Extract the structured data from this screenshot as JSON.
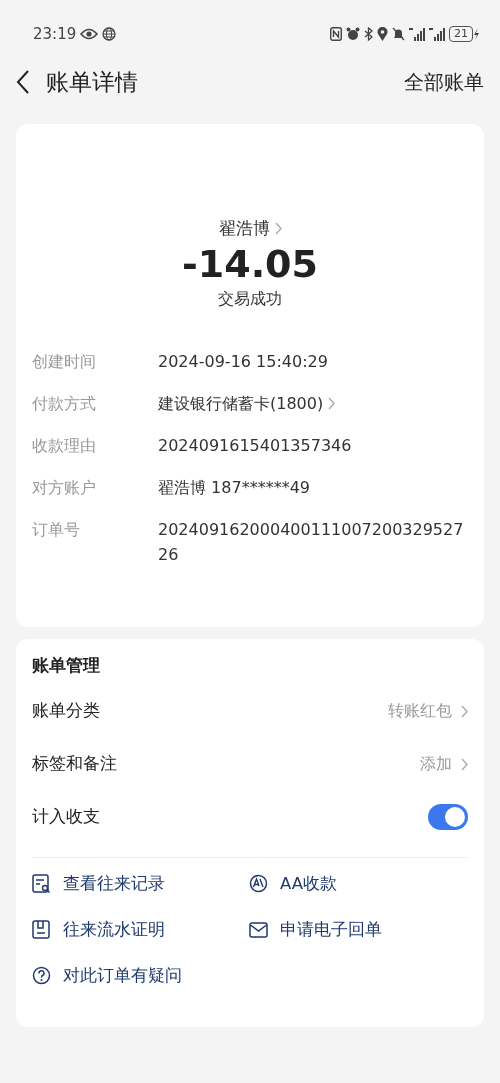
{
  "status_bar": {
    "time": "23:19",
    "battery": "21"
  },
  "header": {
    "title": "账单详情",
    "action": "全部账单"
  },
  "summary": {
    "payee": "翟浩博",
    "amount": "-14.05",
    "status": "交易成功"
  },
  "details": [
    {
      "label": "创建时间",
      "value": "2024-09-16 15:40:29",
      "link": false
    },
    {
      "label": "付款方式",
      "value": "建设银行储蓄卡(1800)",
      "link": true
    },
    {
      "label": "收款理由",
      "value": "2024091615401357346",
      "link": false
    },
    {
      "label": "对方账户",
      "value": "翟浩博 187******49",
      "link": false
    },
    {
      "label": "订单号",
      "value": "20240916200040011100720032952726",
      "link": false
    }
  ],
  "management": {
    "title": "账单管理",
    "rows": [
      {
        "kind": "link",
        "label": "账单分类",
        "value": "转账红包"
      },
      {
        "kind": "link",
        "label": "标签和备注",
        "value": "添加"
      },
      {
        "kind": "switch",
        "label": "计入收支",
        "on": true
      }
    ],
    "actions": [
      {
        "kind": "records",
        "label": "查看往来记录"
      },
      {
        "kind": "aa",
        "label": "AA收款"
      },
      {
        "kind": "proof",
        "label": "往来流水证明"
      },
      {
        "kind": "mail",
        "label": "申请电子回单"
      },
      {
        "kind": "question",
        "label": "对此订单有疑问"
      }
    ]
  }
}
